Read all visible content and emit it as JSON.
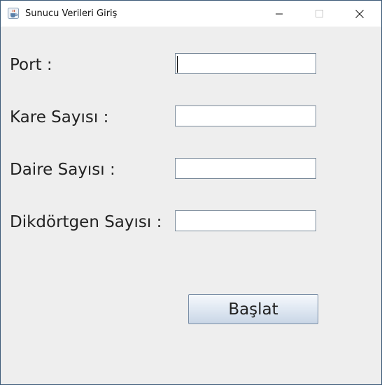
{
  "window": {
    "title": "Sunucu Verileri Giriş",
    "icon": "java-cup-icon"
  },
  "form": {
    "fields": [
      {
        "label": "Port :",
        "value": "",
        "focused": true
      },
      {
        "label": "Kare Sayısı :",
        "value": ""
      },
      {
        "label": "Daire Sayısı :",
        "value": ""
      },
      {
        "label": "Dikdörtgen Sayısı :",
        "value": ""
      }
    ],
    "start_label": "Başlat"
  }
}
